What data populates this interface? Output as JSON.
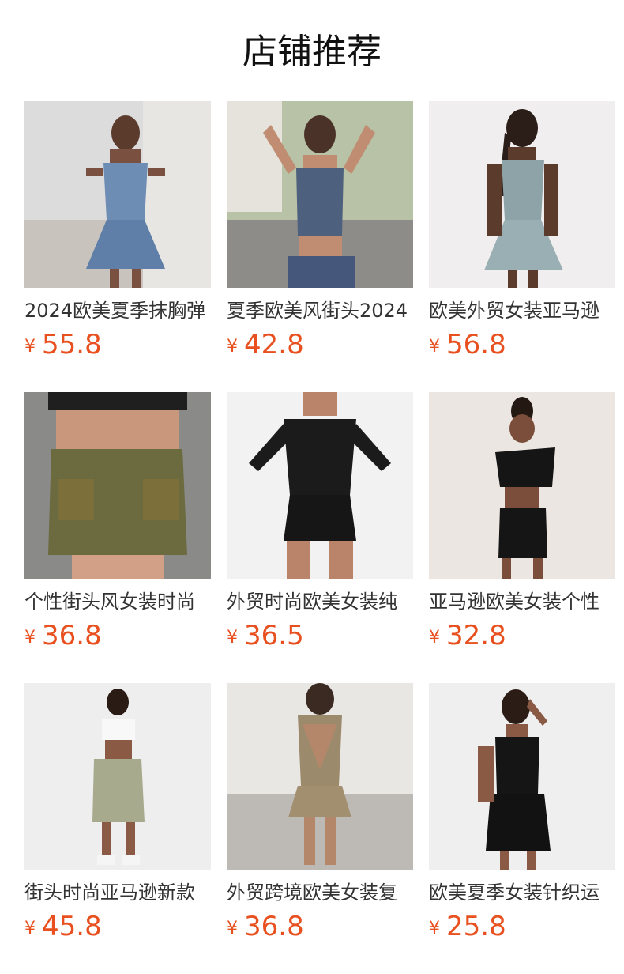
{
  "page": {
    "title": "店铺推荐",
    "currency_symbol": "¥",
    "price_color": "#e8501f"
  },
  "products": [
    {
      "name": "2024欧美夏季抹胸弹",
      "price": "55.8",
      "image": "denim-strapless-ruffle-dress-photo"
    },
    {
      "name": "夏季欧美风街头2024",
      "price": "42.8",
      "image": "denim-halter-crop-top-street-photo"
    },
    {
      "name": "欧美外贸女装亚马逊",
      "price": "56.8",
      "image": "light-denim-strapless-dress-photo"
    },
    {
      "name": "个性街头风女装时尚",
      "price": "36.8",
      "image": "washed-cargo-denim-skirt-photo"
    },
    {
      "name": "外贸时尚欧美女装纯",
      "price": "36.5",
      "image": "black-feather-cuff-romper-photo"
    },
    {
      "name": "亚马逊欧美女装个性",
      "price": "32.8",
      "image": "black-one-shoulder-cutout-dress-photo"
    },
    {
      "name": "街头时尚亚马逊新款",
      "price": "45.8",
      "image": "crop-top-denim-bermuda-shorts-photo"
    },
    {
      "name": "外贸跨境欧美女装复",
      "price": "36.8",
      "image": "khaki-vest-skirt-set-photo"
    },
    {
      "name": "欧美夏季女装针织运",
      "price": "25.8",
      "image": "black-knit-tank-shorts-set-photo"
    }
  ]
}
